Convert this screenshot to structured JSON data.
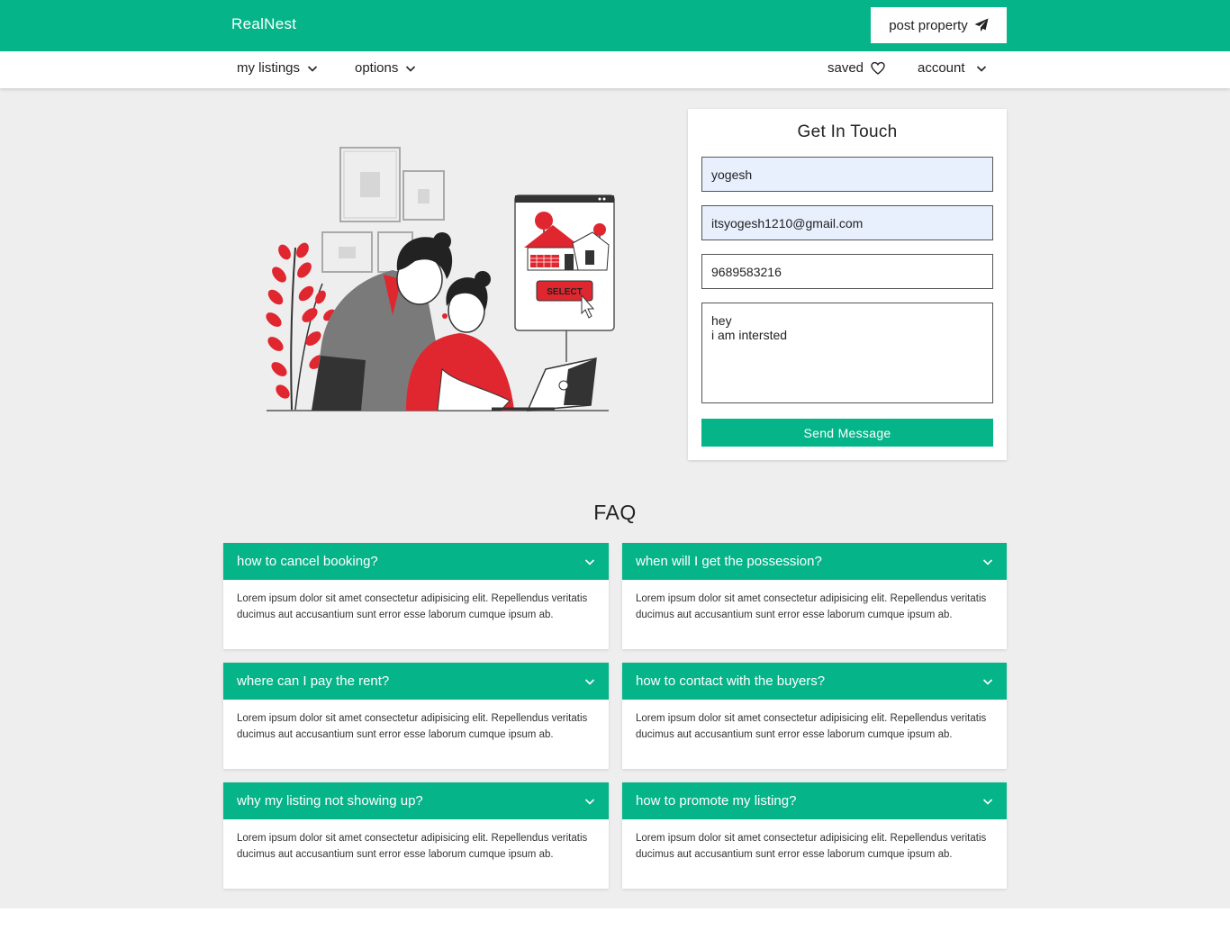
{
  "brand": {
    "name": "RealNest"
  },
  "header": {
    "post_property_label": "post property"
  },
  "nav": {
    "my_listings": "my listings",
    "options": "options",
    "saved": "saved",
    "account": "account"
  },
  "contact": {
    "title": "Get In Touch",
    "name_value": "yogesh",
    "email_value": "itsyogesh1210@gmail.com",
    "phone_value": "9689583216",
    "message_value": "hey\ni am intersted",
    "send_label": "Send Message"
  },
  "illustration": {
    "select_label": "SELECT"
  },
  "faq": {
    "title": "FAQ",
    "items": [
      {
        "question": "how to cancel booking?",
        "answer": "Lorem ipsum dolor sit amet consectetur adipisicing elit. Repellendus veritatis ducimus aut accusantium sunt error esse laborum cumque ipsum ab."
      },
      {
        "question": "when will I get the possession?",
        "answer": "Lorem ipsum dolor sit amet consectetur adipisicing elit. Repellendus veritatis ducimus aut accusantium sunt error esse laborum cumque ipsum ab."
      },
      {
        "question": "where can I pay the rent?",
        "answer": "Lorem ipsum dolor sit amet consectetur adipisicing elit. Repellendus veritatis ducimus aut accusantium sunt error esse laborum cumque ipsum ab."
      },
      {
        "question": "how to contact with the buyers?",
        "answer": "Lorem ipsum dolor sit amet consectetur adipisicing elit. Repellendus veritatis ducimus aut accusantium sunt error esse laborum cumque ipsum ab."
      },
      {
        "question": "why my listing not showing up?",
        "answer": "Lorem ipsum dolor sit amet consectetur adipisicing elit. Repellendus veritatis ducimus aut accusantium sunt error esse laborum cumque ipsum ab."
      },
      {
        "question": "how to promote my listing?",
        "answer": "Lorem ipsum dolor sit amet consectetur adipisicing elit. Repellendus veritatis ducimus aut accusantium sunt error esse laborum cumque ipsum ab."
      }
    ]
  },
  "icons": {
    "post": "paper-plane-icon",
    "dropdown": "chevron-down-icon",
    "saved": "heart-icon"
  },
  "colors": {
    "accent": "#06b489",
    "background": "#eeeeee",
    "illustration_red": "#e0262e"
  }
}
